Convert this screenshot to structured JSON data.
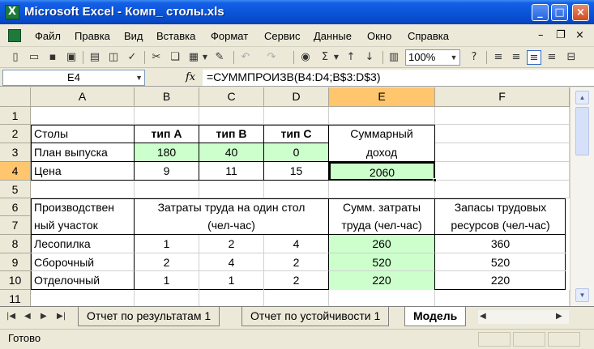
{
  "window": {
    "title": "Microsoft Excel - Комп_ столы.xls"
  },
  "menu": [
    "Файл",
    "Правка",
    "Вид",
    "Вставка",
    "Формат",
    "Сервис",
    "Данные",
    "Окно",
    "Справка"
  ],
  "toolbar": {
    "zoom": "100%"
  },
  "formula_bar": {
    "name_box": "E4",
    "fx": "fx",
    "formula": "=СУММПРОИЗВ(B4:D4;B$3:D$3)"
  },
  "columns": [
    "A",
    "B",
    "C",
    "D",
    "E",
    "F"
  ],
  "rows": [
    "1",
    "2",
    "3",
    "4",
    "5",
    "6",
    "7",
    "8",
    "9",
    "10",
    "11"
  ],
  "sheet": {
    "r2": {
      "a": "Столы",
      "b": "тип A",
      "c": "тип B",
      "d": "тип C",
      "e": "Суммарный"
    },
    "r3": {
      "a": "План выпуска",
      "b": "180",
      "c": "40",
      "d": "0",
      "e": "доход"
    },
    "r4": {
      "a": "Цена",
      "b": "9",
      "c": "11",
      "d": "15",
      "e": "2060"
    },
    "r6": {
      "a": "Производствен",
      "bcd": "Затраты труда на один стол",
      "e": "Сумм. затраты",
      "f": "Запасы трудовых"
    },
    "r7": {
      "a": "ный участок",
      "bcd": "(чел-час)",
      "e": "труда (чел-час)",
      "f": "ресурсов (чел-час)"
    },
    "r8": {
      "a": "Лесопилка",
      "b": "1",
      "c": "2",
      "d": "4",
      "e": "260",
      "f": "360"
    },
    "r9": {
      "a": "Сборочный",
      "b": "2",
      "c": "4",
      "d": "2",
      "e": "520",
      "f": "520"
    },
    "r10": {
      "a": "Отделочный",
      "b": "1",
      "c": "1",
      "d": "2",
      "e": "220",
      "f": "220"
    }
  },
  "tabs": [
    "Отчет по результатам 1",
    "Отчет по устойчивости 1",
    "Модель"
  ],
  "status": "Готово",
  "colors": {
    "green_fill": "#ccffcc",
    "active_header": "#ffc66e",
    "title_bar": "#0a55d8"
  }
}
